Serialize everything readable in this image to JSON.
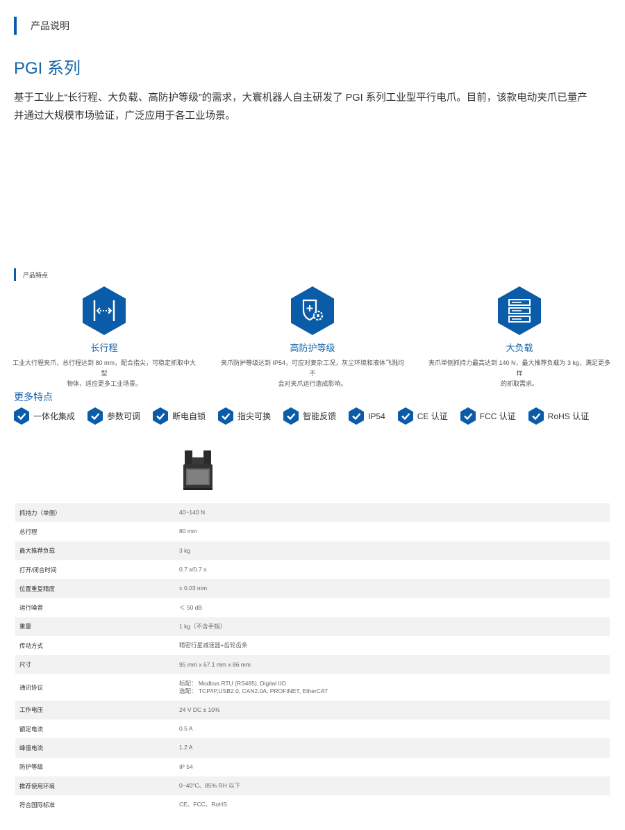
{
  "section": {
    "label": "产品说明"
  },
  "series": {
    "title": "PGI 系列"
  },
  "intro": {
    "line1": "基于工业上“长行程、大负载、高防护等级”的需求，大寰机器人自主研发了 PGI 系列工业型平行电爪。目前，该款电动夹爪已量产",
    "line2": "并通过大规模市场验证，广泛应用于各工业场景。"
  },
  "features_head": {
    "label": "产品特点"
  },
  "features": [
    {
      "icon": "long-stroke-icon",
      "title": "长行程",
      "desc1": "工业大行程夹爪，总行程达到 80 mm，配合指尖，可稳定抓取中大型",
      "desc2": "物体，适应更多工业场景。"
    },
    {
      "icon": "shield-gear-icon",
      "title": "高防护等级",
      "desc1": "夹爪防护等级达到 IP54，可应对复杂工况，灰尘环境和液体飞溅均不",
      "desc2": "会对夹爪运行造成影响。"
    },
    {
      "icon": "server-rack-icon",
      "title": "大负载",
      "desc1": "夹爪单侧抓持力最高达到 140 N，最大推荐负载为 3 kg，满足更多样",
      "desc2": "的抓取需求。"
    }
  ],
  "more": {
    "title": "更多特点",
    "tags": [
      "一体化集成",
      "参数可调",
      "断电自锁",
      "指尖可换",
      "智能反馈",
      "IP54",
      "CE 认证",
      "FCC 认证",
      "RoHS 认证"
    ]
  },
  "specs": [
    {
      "k": "抓持力（单侧）",
      "v": "40~140 N"
    },
    {
      "k": "总行程",
      "v": "80 mm"
    },
    {
      "k": "最大推荐负载",
      "v": "3 kg"
    },
    {
      "k": "打开/闭合时间",
      "v": "0.7 s/0.7 s"
    },
    {
      "k": "位置重复精度",
      "v": "± 0.03 mm"
    },
    {
      "k": "运行噪音",
      "v": "＜ 50 dB"
    },
    {
      "k": "重量",
      "v": "1 kg（不含手指）"
    },
    {
      "k": "传动方式",
      "v": "精密行星减速器+齿轮齿条"
    },
    {
      "k": "尺寸",
      "v": "95 mm x 67.1 mm x 86 mm"
    },
    {
      "k": "通讯协议",
      "v": "标配：  Modbus RTU (RS485), Digital I/O",
      "v2": "选配：  TCP/IP,USB2.0, CAN2.0A, PROFINET, EtherCAT"
    },
    {
      "k": "工作电压",
      "v": "24 V DC ± 10%"
    },
    {
      "k": "额定电流",
      "v": "0.5 A"
    },
    {
      "k": "峰值电流",
      "v": "1.2 A"
    },
    {
      "k": "防护等级",
      "v": "IP 54"
    },
    {
      "k": "推荐使用环境",
      "v": "0~40°C、85% RH 以下"
    },
    {
      "k": "符合国际标准",
      "v": "CE、FCC、RoHS"
    }
  ],
  "colors": {
    "accent": "#1565a8",
    "hex_fill": "#0b5ca8",
    "row_alt": "#f2f2f2"
  }
}
